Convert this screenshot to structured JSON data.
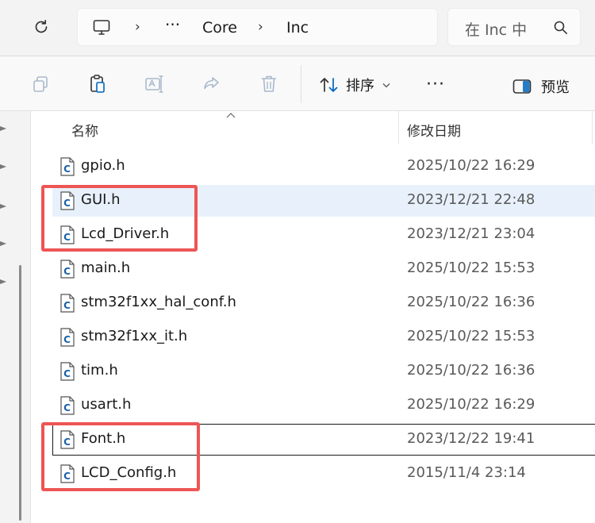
{
  "address_bar": {
    "crumbs": [
      "Core",
      "Inc"
    ],
    "overflow": "···",
    "separator": "›"
  },
  "search": {
    "placeholder": "在 Inc 中"
  },
  "toolbar": {
    "sort_label": "排序",
    "more_label": "···",
    "preview_label": "预览"
  },
  "columns": {
    "name": "名称",
    "date": "修改日期"
  },
  "files": [
    {
      "name": "gpio.h",
      "date": "2025/10/22 16:29"
    },
    {
      "name": "GUI.h",
      "date": "2023/12/21 22:48"
    },
    {
      "name": "Lcd_Driver.h",
      "date": "2023/12/21 23:04"
    },
    {
      "name": "main.h",
      "date": "2025/10/22 15:53"
    },
    {
      "name": "stm32f1xx_hal_conf.h",
      "date": "2025/10/22 16:36"
    },
    {
      "name": "stm32f1xx_it.h",
      "date": "2025/10/22 15:53"
    },
    {
      "name": "tim.h",
      "date": "2025/10/22 16:36"
    },
    {
      "name": "usart.h",
      "date": "2025/10/22 16:29"
    },
    {
      "name": "Font.h",
      "date": "2023/12/22 19:41"
    },
    {
      "name": "LCD_Config.h",
      "date": "2015/11/4 23:14"
    }
  ],
  "file_icon_letter": "C",
  "colors": {
    "highlight": "#ee5555",
    "selected_row": "#e8f1fb",
    "accent": "#0067c0"
  }
}
